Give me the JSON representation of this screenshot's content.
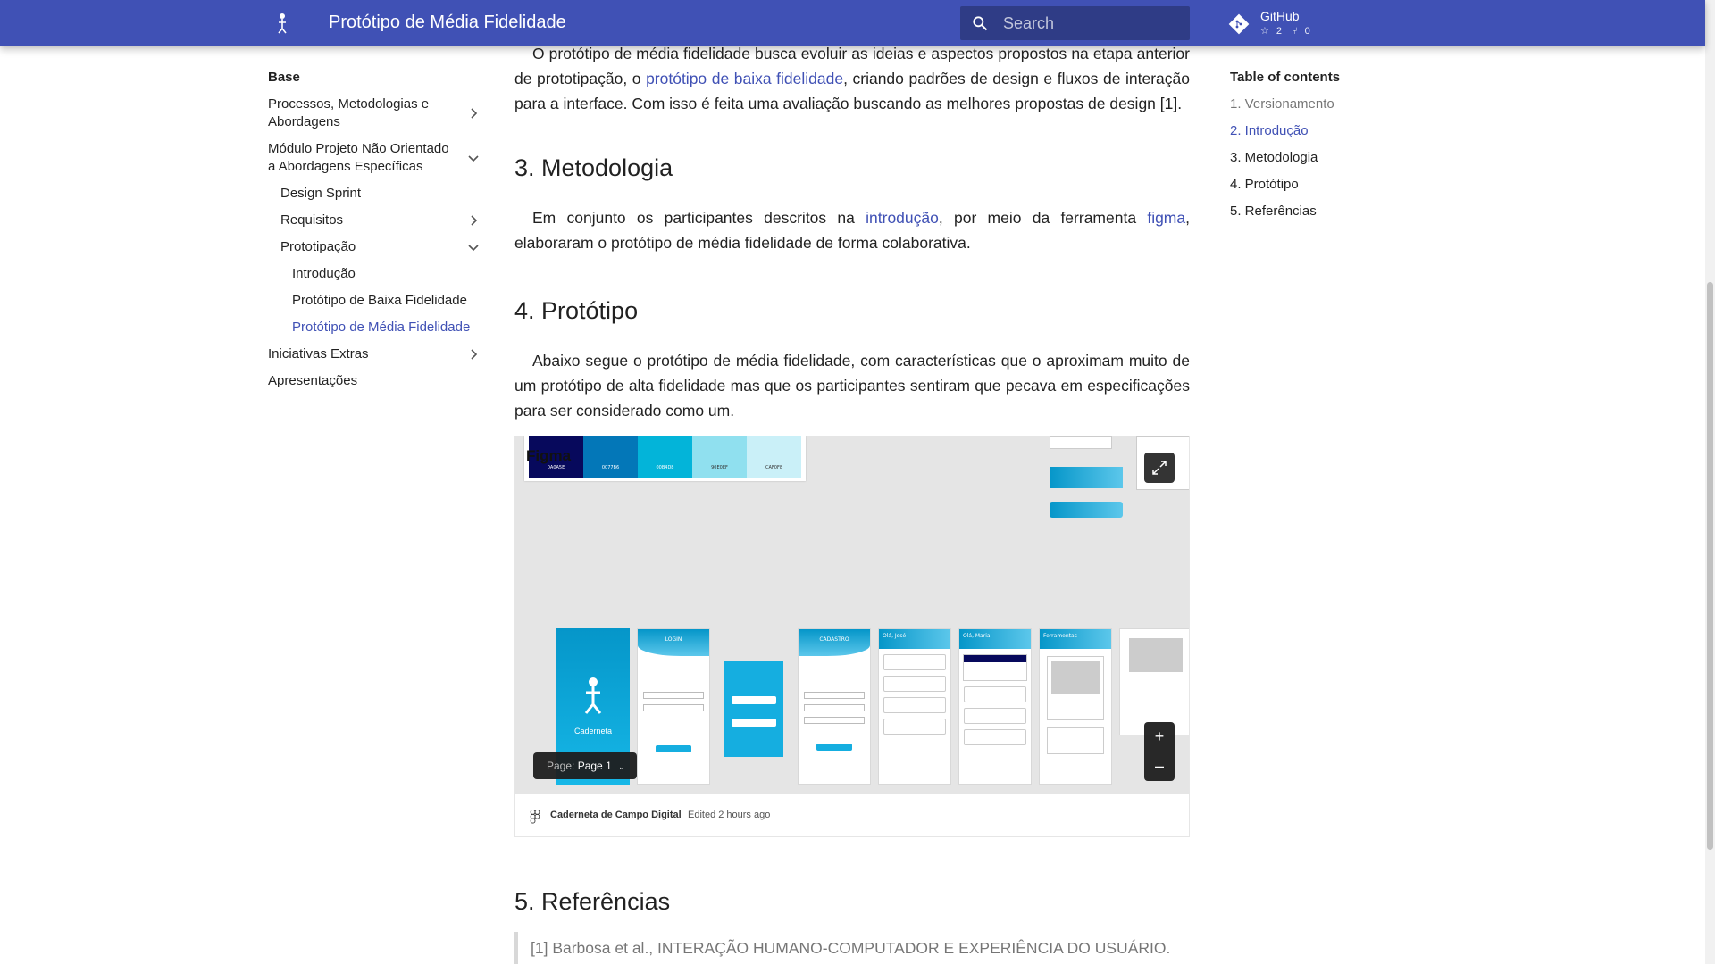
{
  "header": {
    "title": "Protótipo de Média Fidelidade",
    "search_placeholder": "Search",
    "repo": {
      "name": "GitHub",
      "stars": "2",
      "forks": "0"
    }
  },
  "nav": {
    "section_title": "Base",
    "items": [
      {
        "label": "Processos, Metodologias e Abordagens"
      },
      {
        "label": "Módulo Projeto Não Orientado a Abordagens Específicas"
      },
      {
        "label": "Design Sprint"
      },
      {
        "label": "Requisitos"
      },
      {
        "label": "Prototipação"
      },
      {
        "label": "Introdução"
      },
      {
        "label": "Protótipo de Baixa Fidelidade"
      },
      {
        "label": "Protótipo de Média Fidelidade"
      },
      {
        "label": "Iniciativas Extras"
      },
      {
        "label": "Apresentações"
      }
    ]
  },
  "content": {
    "intro_p": {
      "before": "O protótipo de média fidelidade busca evoluir as ideias e aspectos propostos na etapa anterior de prototipação, o ",
      "link": "protótipo de baixa fidelidade",
      "after": ", criando padrões de design e fluxos de interação para a interface. Com isso é feita uma avaliação buscando as melhores propostas de design [1]."
    },
    "metodologia": {
      "heading": "3. Metodologia",
      "before": "Em conjunto os participantes descritos na ",
      "link1": "introdução",
      "middle": ", por meio da ferramenta ",
      "link2": "figma",
      "after": ", elaboraram o protótipo de média fidelidade de forma colaborativa."
    },
    "prototipo": {
      "heading": "4. Protótipo",
      "text": "Abaixo segue o protótipo de média fidelidade, com características que o aproximam muito de um protótipo de alta fidelidade mas que os participantes sentiram que pecava em especificações para ser considerado como um."
    },
    "figma_embed": {
      "logo_text": "Figma",
      "swatches": [
        {
          "label": "0A0A5E",
          "color": "#07095c"
        },
        {
          "label": "0077B6",
          "color": "#0377b8"
        },
        {
          "label": "00B4D8",
          "color": "#03b4d9"
        },
        {
          "label": "90E0EF",
          "color": "#90e0ef"
        },
        {
          "label": "CAF0F8",
          "color": "#caf0f8"
        }
      ],
      "screens": [
        "Caderneta",
        "LOGIN",
        "CADASTRO",
        "Olá, José",
        "Olá, Maria",
        "Ferramentas"
      ],
      "page_label": "Page:",
      "page_value": "Page 1",
      "file_name": "Caderneta de Campo Digital",
      "edited": "Edited 2 hours ago"
    },
    "referencias": {
      "heading": "5. Referências",
      "ref1": "[1] Barbosa et al., INTERAÇÃO HUMANO-COMPUTADOR E EXPERIÊNCIA DO USUÁRIO."
    }
  },
  "toc": {
    "title": "Table of contents",
    "items": [
      {
        "label": "1. Versionamento"
      },
      {
        "label": "2. Introdução"
      },
      {
        "label": "3. Metodologia"
      },
      {
        "label": "4. Protótipo"
      },
      {
        "label": "5. Referências"
      }
    ]
  },
  "colors": {
    "primary": "#4051b5",
    "link": "#4051b5"
  }
}
